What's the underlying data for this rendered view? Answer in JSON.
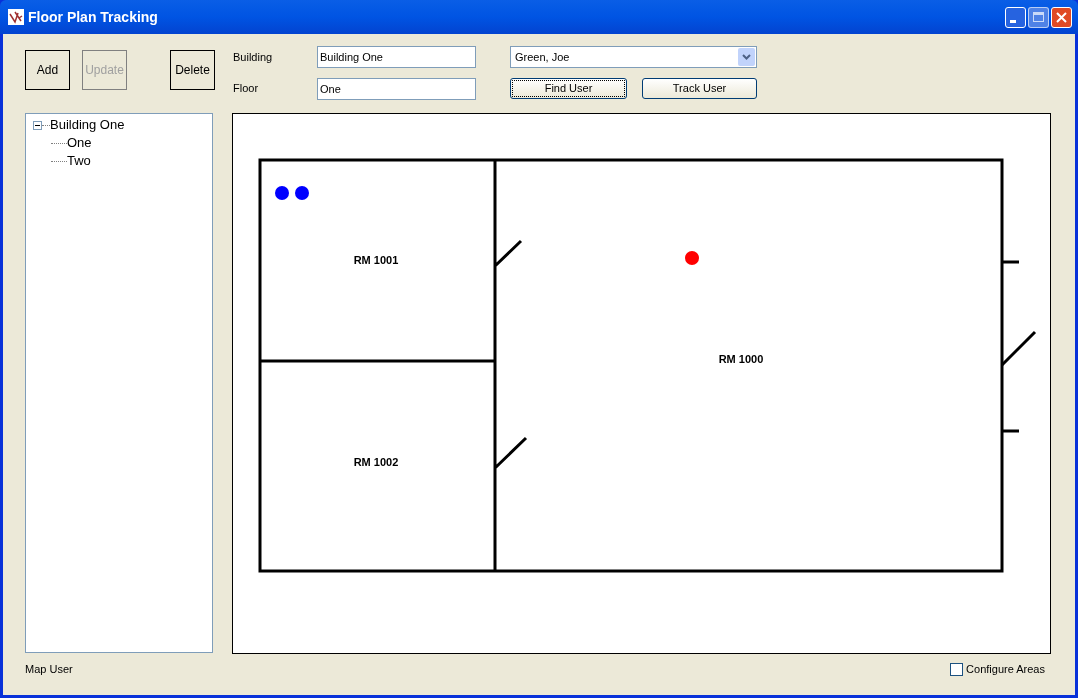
{
  "window": {
    "title": "Floor Plan Tracking"
  },
  "toolbar": {
    "buttons": [
      {
        "label": "Add",
        "disabled": false
      },
      {
        "label": "Update",
        "disabled": true
      },
      {
        "label": "Delete",
        "disabled": false
      }
    ]
  },
  "form": {
    "building_label": "Building",
    "building_value": "Building One",
    "floor_label": "Floor",
    "floor_value": "One",
    "user_value": "Green, Joe",
    "find_button": "Find User",
    "track_button": "Track User"
  },
  "tree": [
    {
      "label": "Building One",
      "expanded": true,
      "children": [
        {
          "label": "One"
        },
        {
          "label": "Two"
        }
      ]
    }
  ],
  "floor_plan": {
    "rooms": [
      {
        "label": "RM 1001"
      },
      {
        "label": "RM 1002"
      },
      {
        "label": "RM 1000"
      }
    ],
    "markers": [
      {
        "color": "#0000ff"
      },
      {
        "color": "#0000ff"
      },
      {
        "color": "#ff0000"
      }
    ]
  },
  "status": {
    "text": "Map User",
    "configure_label": "Configure Areas",
    "configure_checked": false
  }
}
